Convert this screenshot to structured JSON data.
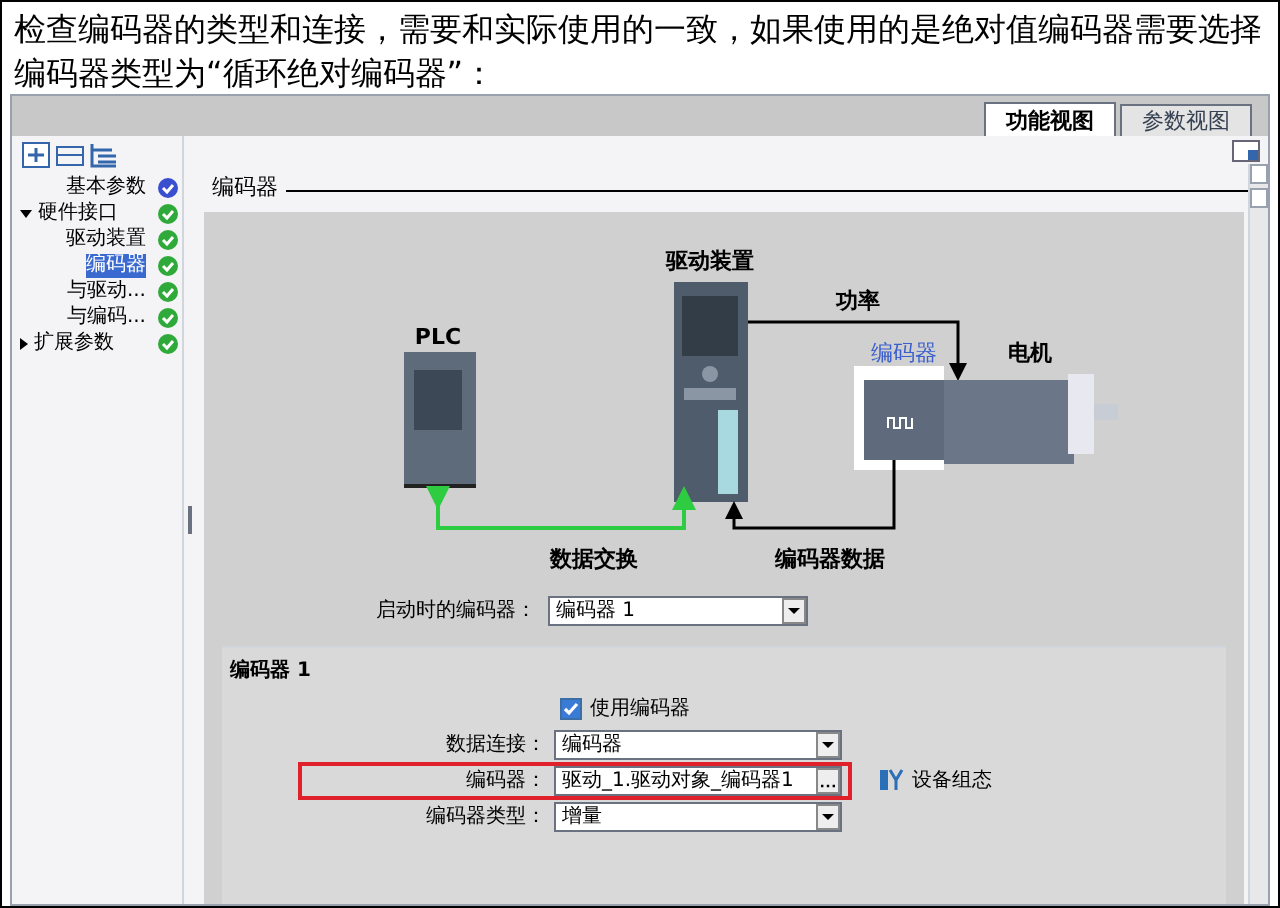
{
  "intro": "检查编码器的类型和连接，需要和实际使用的一致，如果使用的是绝对值编码器需要选择编码器类型为“循环绝对编码器”：",
  "tabs": [
    {
      "label": "功能视图",
      "selected": true
    },
    {
      "label": "参数视图",
      "selected": false
    }
  ],
  "sidebar": {
    "items": [
      {
        "label": "基本参数",
        "color": "#3a4fcf",
        "selected": false
      },
      {
        "label": "硬件接口",
        "color": "#2faa3a",
        "selected": false,
        "expanded": true,
        "children": [
          {
            "label": "驱动装置",
            "color": "#2faa3a",
            "selected": false
          },
          {
            "label": "编码器",
            "color": "#2faa3a",
            "selected": true
          },
          {
            "label": "与驱动...",
            "color": "#2faa3a",
            "selected": false
          },
          {
            "label": "与编码...",
            "color": "#2faa3a",
            "selected": false
          }
        ]
      },
      {
        "label": "扩展参数",
        "color": "#2faa3a",
        "selected": false,
        "expanded": false
      }
    ]
  },
  "section_title": "编码器",
  "diagram": {
    "plc": "PLC",
    "drive": "驱动装置",
    "power": "功率",
    "encoder": "编码器",
    "motor": "电机",
    "data_exchange": "数据交换",
    "encoder_data": "编码器数据"
  },
  "startup_encoder": {
    "label": "启动时的编码器：",
    "value": "编码器 1"
  },
  "encoder_panel": {
    "title": "编码器 1",
    "use_encoder": {
      "label": "使用编码器",
      "checked": true
    },
    "fields": [
      {
        "kind": "dropdown",
        "label": "数据连接：",
        "value": "编码器",
        "highlighted": false
      },
      {
        "kind": "browse",
        "label": "编码器：",
        "value": "驱动_1.驱动对象_编码器1",
        "highlighted": true,
        "link": "设备组态"
      },
      {
        "kind": "dropdown",
        "label": "编码器类型：",
        "value": "增量",
        "highlighted": false
      }
    ]
  }
}
